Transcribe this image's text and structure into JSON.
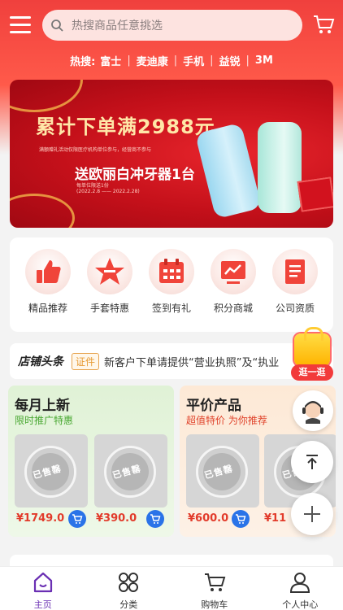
{
  "header": {
    "search_placeholder": "热搜商品任意挑选",
    "hot_label": "热搜:",
    "hot_terms": [
      "富士",
      "麦迪康",
      "手机",
      "益锐",
      "3M"
    ]
  },
  "banner": {
    "title": "累计下单满2988元",
    "subtitle": "满额赠礼活动仅限医疗机构单位参与，经营商不参与",
    "gift": "送欧丽白冲牙器1台",
    "note_line1": "每单位限送1份",
    "note_line2": "(2022.2.8 —— 2022.2.28)"
  },
  "quick_icons": [
    {
      "label": "精品推荐",
      "icon": "thumbs-up-icon"
    },
    {
      "label": "手套特惠",
      "icon": "star-icon"
    },
    {
      "label": "签到有礼",
      "icon": "calendar-icon"
    },
    {
      "label": "积分商城",
      "icon": "chart-icon"
    },
    {
      "label": "公司资质",
      "icon": "document-icon"
    }
  ],
  "news": {
    "title": "店铺头条",
    "badge": "证件",
    "text": "新客户下单请提供“营业执照”及“执业"
  },
  "float_shop": {
    "label": "逛一逛"
  },
  "monthly": {
    "title": "每月上新",
    "subtitle": "限时推广特惠",
    "products": [
      {
        "price": "¥1749.0",
        "stamp": "已售罄"
      },
      {
        "price": "¥390.0",
        "stamp": "已售罄"
      }
    ]
  },
  "affordable": {
    "title": "平价产品",
    "subtitle": "超值特价 为你推荐",
    "products": [
      {
        "price": "¥600.0",
        "stamp": "已售罄"
      },
      {
        "price": "¥11",
        "stamp": "已售罄"
      }
    ]
  },
  "tabbar": [
    {
      "label": "主页",
      "icon": "home-icon",
      "active": true
    },
    {
      "label": "分类",
      "icon": "category-icon",
      "active": false
    },
    {
      "label": "购物车",
      "icon": "cart-icon",
      "active": false
    },
    {
      "label": "个人中心",
      "icon": "user-icon",
      "active": false
    }
  ],
  "colors": {
    "brand_red": "#f0403d",
    "active_tab": "#6a2fb3",
    "price_red": "#e23b2b",
    "cart_blue": "#2a73e8"
  }
}
